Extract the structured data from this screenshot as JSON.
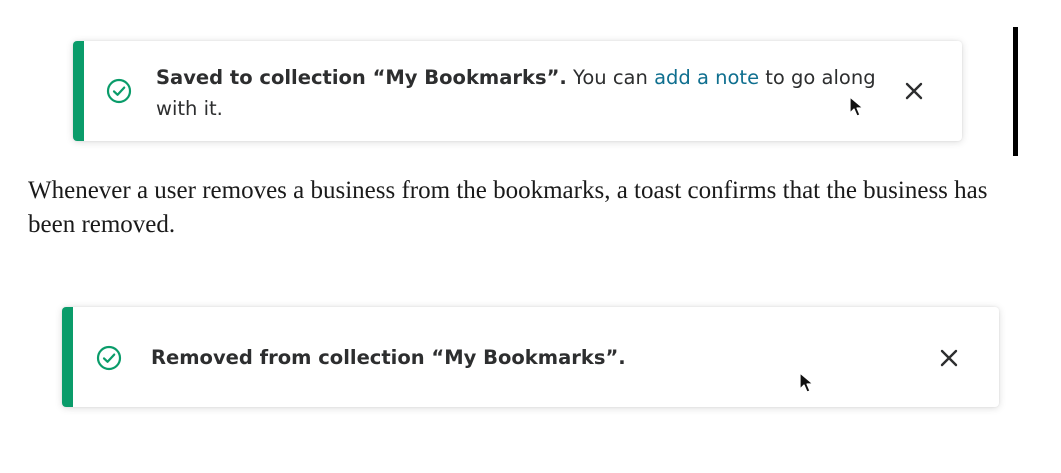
{
  "toast_saved": {
    "bold_text": "Saved to collection “My Bookmarks”.",
    "text_before_link": " You can ",
    "link_text": "add a note",
    "text_after_link": " to go along with it."
  },
  "description": "Whenever a user removes a business from the bookmarks, a toast confirms that the business has been removed.",
  "toast_removed": {
    "bold_text": "Removed from collection “My Bookmarks”."
  },
  "icons": {
    "success": "check-circle-icon",
    "dismiss": "close-icon",
    "pointer": "mouse-cursor-icon"
  },
  "colors": {
    "success_accent": "#0a9c6a",
    "link": "#0f6f8f",
    "text": "#2d2e2f"
  }
}
